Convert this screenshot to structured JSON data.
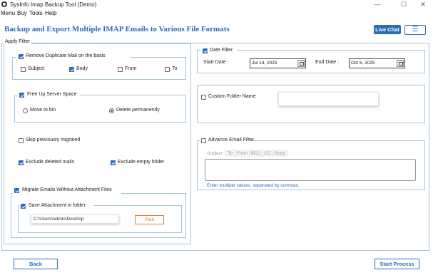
{
  "window": {
    "title": "SysInfo Imap Backup Tool (Demo)",
    "minimize": "—",
    "maximize": "☐",
    "close": "✕"
  },
  "menu": [
    "Menu",
    "Buy",
    "Tools",
    "Help"
  ],
  "header": {
    "title": "Backup and Export Multiple IMAP Emails to Various File Formats",
    "live_chat": "Live Chat",
    "hamburger": "☰"
  },
  "apply_filter": {
    "legend": "Apply Filter",
    "remove_duplicates": {
      "label": "Remove Duplicate Mail on the basis",
      "checked": true,
      "options": [
        {
          "label": "Subject",
          "checked": false
        },
        {
          "label": "Body",
          "checked": true
        },
        {
          "label": "From",
          "checked": false
        },
        {
          "label": "To",
          "checked": false
        }
      ]
    },
    "free_up": {
      "label": "Free Up Server Space",
      "checked": true,
      "move_to_bin": "Move to bin",
      "delete_permanently": "Delete permanently",
      "selected": "delete_permanently"
    },
    "skip_migrated": {
      "label": "Skip previously migrated",
      "checked": false
    },
    "exclude_deleted": {
      "label": "Exclude deleted mails",
      "checked": true
    },
    "exclude_empty": {
      "label": "Exclude empty folder",
      "checked": true
    },
    "migrate_without_attachment": {
      "label": "Migrate Emails Without Attachment Files",
      "checked": true,
      "save_attachment": {
        "label": "Save Attachment in folder",
        "checked": true
      },
      "path_value": "C:\\Users\\admin\\Desktop",
      "path_button": "Path"
    }
  },
  "date_filter": {
    "label": "Date Filter",
    "checked": true,
    "start_label": "Start Date :",
    "start_value": "Jul 14, 2025",
    "end_label": "End Date :",
    "end_value": "Oct 6, 2025"
  },
  "custom_folder": {
    "label": "Custom Folder Name",
    "checked": false,
    "value": ""
  },
  "advanced_filter": {
    "label": "Advance Email Filter",
    "checked": false,
    "tabs": [
      "Subject",
      "To",
      "From",
      "BCC",
      "CC",
      "Body"
    ],
    "hint": "Enter multiple values, separated by commas."
  },
  "footer": {
    "back": "Back",
    "start": "Start Process"
  },
  "colors": {
    "accent": "#2b6cb7",
    "border": "#a8c3e0",
    "path_button": "#e07b39"
  }
}
